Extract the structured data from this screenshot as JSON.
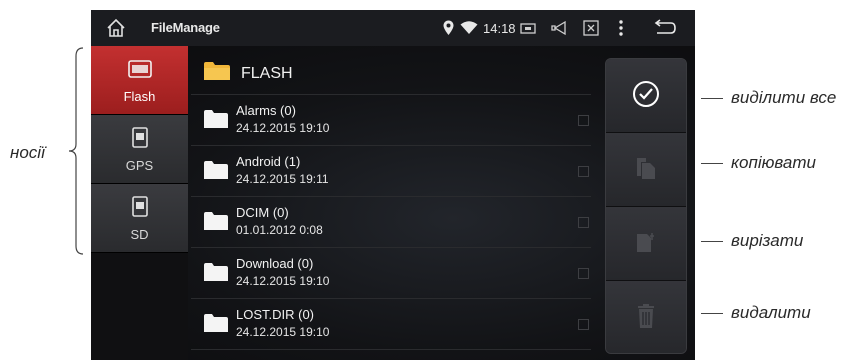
{
  "status_bar": {
    "app_title": "FileManage",
    "time": "14:18"
  },
  "media": [
    {
      "label": "Flash",
      "icon": "usb-flash-icon",
      "active": true
    },
    {
      "label": "GPS",
      "icon": "sd-card-icon",
      "active": false
    },
    {
      "label": "SD",
      "icon": "sd-card-icon",
      "active": false
    }
  ],
  "list": {
    "title": "FLASH",
    "items": [
      {
        "name": "Alarms (0)",
        "date": "24.12.2015 19:10"
      },
      {
        "name": "Android (1)",
        "date": "24.12.2015 19:11"
      },
      {
        "name": "DCIM (0)",
        "date": "01.01.2012 0:08"
      },
      {
        "name": "Download (0)",
        "date": "24.12.2015 19:10"
      },
      {
        "name": "LOST.DIR (0)",
        "date": "24.12.2015 19:10"
      }
    ]
  },
  "actions": [
    {
      "icon": "select-all-icon",
      "enabled": true
    },
    {
      "icon": "copy-icon",
      "enabled": false
    },
    {
      "icon": "cut-icon",
      "enabled": false
    },
    {
      "icon": "trash-icon",
      "enabled": false
    }
  ],
  "annotations": {
    "media": "носії",
    "select_all": "виділити все",
    "copy": "копіювати",
    "cut": "вирізати",
    "delete": "видалити"
  },
  "colors": {
    "accent_red": "#b02424",
    "panel": "#2d2e32",
    "background": "#0d0d0f"
  }
}
